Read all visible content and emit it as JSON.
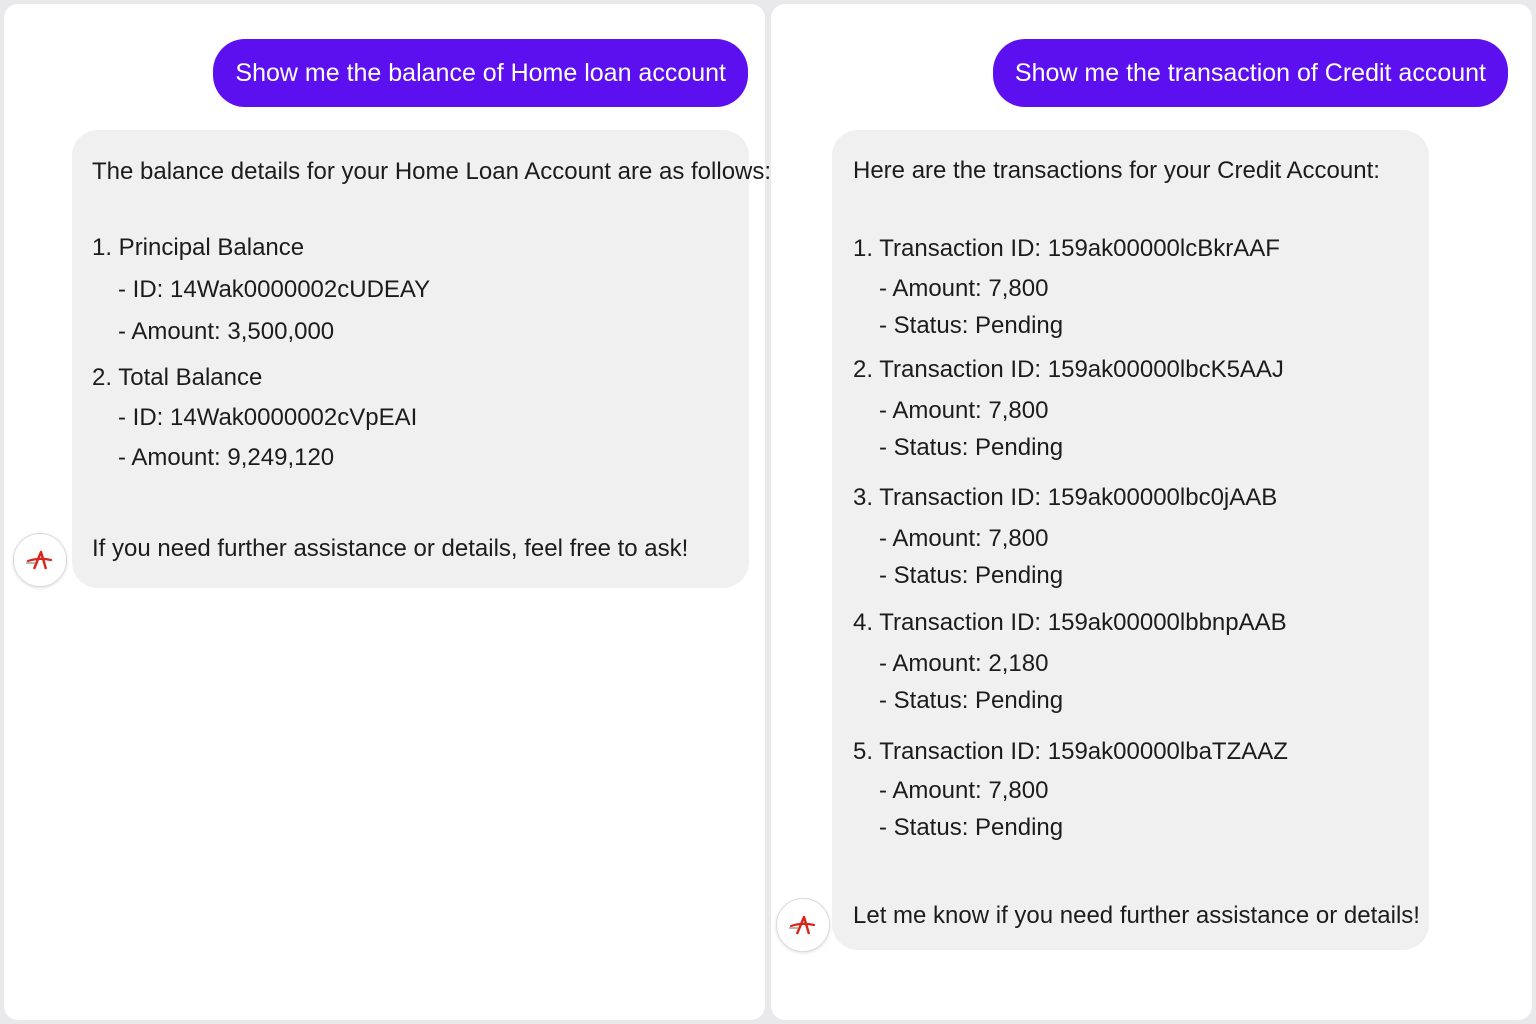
{
  "colors": {
    "user_bubble": "#5c10f0",
    "bot_bubble": "#f0f0f0",
    "logo_red": "#d9261c"
  },
  "left": {
    "user_message": "Show me the balance of Home loan account",
    "bot": {
      "intro": "The balance details for your Home Loan Account are as follows:",
      "items": [
        {
          "title": "1. Principal Balance",
          "id": "- ID: 14Wak0000002cUDEAY",
          "amount": "- Amount: 3,500,000"
        },
        {
          "title": "2. Total Balance",
          "id": "- ID: 14Wak0000002cVpEAI",
          "amount": "- Amount: 9,249,120"
        }
      ],
      "outro": "If you need further assistance or details, feel free to ask!"
    },
    "avatar_icon": "bank-logo-icon"
  },
  "right": {
    "user_message": "Show me the transaction of Credit account",
    "bot": {
      "intro": "Here are the transactions for your Credit Account:",
      "transactions": [
        {
          "title": "1. Transaction ID: 159ak00000lcBkrAAF",
          "amount": "- Amount: 7,800",
          "status": "- Status: Pending"
        },
        {
          "title": "2. Transaction ID: 159ak00000lbcK5AAJ",
          "amount": "- Amount: 7,800",
          "status": "- Status: Pending"
        },
        {
          "title": "3. Transaction ID: 159ak00000lbc0jAAB",
          "amount": "- Amount: 7,800",
          "status": "- Status: Pending"
        },
        {
          "title": "4. Transaction ID: 159ak00000lbbnpAAB",
          "amount": "- Amount: 2,180",
          "status": "- Status: Pending"
        },
        {
          "title": "5. Transaction ID: 159ak00000lbaTZAAZ",
          "amount": "- Amount: 7,800",
          "status": "- Status: Pending"
        }
      ],
      "outro": "Let me know if you need further assistance or details!"
    },
    "avatar_icon": "bank-logo-icon"
  }
}
